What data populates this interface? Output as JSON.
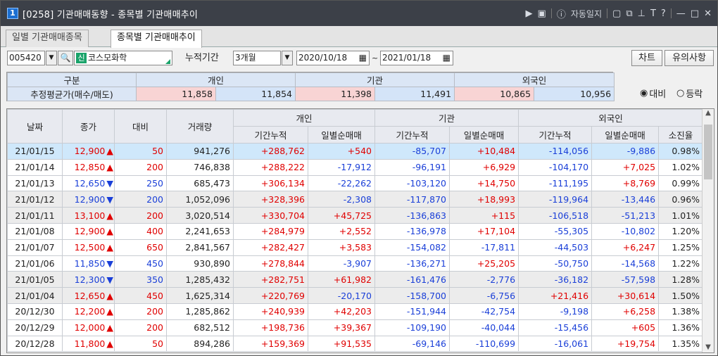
{
  "window": {
    "number": "1",
    "title": "[0258] 기관매매동향 - 종목별 기관매매추이",
    "journal_label": "자동일지"
  },
  "tabs": [
    {
      "label": "일별 기관매매종목"
    },
    {
      "label": "종목별 기관매매추이"
    }
  ],
  "toolbar": {
    "code": "005420",
    "badge": "신",
    "stock_name": "코스모화학",
    "period_label": "누적기간",
    "period_value": "3개월",
    "date_from": "2020/10/18",
    "date_sep": "~",
    "date_to": "2021/01/18",
    "chart_button": "차트",
    "notes_button": "유의사항"
  },
  "summary": {
    "header": [
      "구분",
      "개인",
      "기관",
      "외국인"
    ],
    "row_label": "추정평균가(매수/매도)",
    "values": [
      "11,858",
      "11,854",
      "11,398",
      "11,491",
      "10,865",
      "10,956"
    ]
  },
  "radio": {
    "opt1": "대비",
    "opt2": "등락",
    "selected": "대비"
  },
  "grid": {
    "headers": {
      "date": "날짜",
      "close": "종가",
      "change": "대비",
      "volume": "거래량",
      "individual": "개인",
      "institution": "기관",
      "foreign": "외국인",
      "cum": "기간누적",
      "daily": "일별순매매",
      "exhaust": "소진율"
    },
    "rows": [
      [
        "21/01/15",
        "12,900",
        "up",
        "50",
        "941,276",
        "+288,762",
        "+540",
        "-85,707",
        "+10,484",
        "-114,056",
        "-9,886",
        "0.98%"
      ],
      [
        "21/01/14",
        "12,850",
        "up",
        "200",
        "746,838",
        "+288,222",
        "-17,912",
        "-96,191",
        "+6,929",
        "-104,170",
        "+7,025",
        "1.02%"
      ],
      [
        "21/01/13",
        "12,650",
        "down",
        "250",
        "685,473",
        "+306,134",
        "-22,262",
        "-103,120",
        "+14,750",
        "-111,195",
        "+8,769",
        "0.99%"
      ],
      [
        "21/01/12",
        "12,900",
        "down",
        "200",
        "1,052,096",
        "+328,396",
        "-2,308",
        "-117,870",
        "+18,993",
        "-119,964",
        "-13,446",
        "0.96%"
      ],
      [
        "21/01/11",
        "13,100",
        "up",
        "200",
        "3,020,514",
        "+330,704",
        "+45,725",
        "-136,863",
        "+115",
        "-106,518",
        "-51,213",
        "1.01%"
      ],
      [
        "21/01/08",
        "12,900",
        "up",
        "400",
        "2,241,653",
        "+284,979",
        "+2,552",
        "-136,978",
        "+17,104",
        "-55,305",
        "-10,802",
        "1.20%"
      ],
      [
        "21/01/07",
        "12,500",
        "up",
        "650",
        "2,841,567",
        "+282,427",
        "+3,583",
        "-154,082",
        "-17,811",
        "-44,503",
        "+6,247",
        "1.25%"
      ],
      [
        "21/01/06",
        "11,850",
        "down",
        "450",
        "930,890",
        "+278,844",
        "-3,907",
        "-136,271",
        "+25,205",
        "-50,750",
        "-14,568",
        "1.22%"
      ],
      [
        "21/01/05",
        "12,300",
        "down",
        "350",
        "1,285,432",
        "+282,751",
        "+61,982",
        "-161,476",
        "-2,776",
        "-36,182",
        "-57,598",
        "1.28%"
      ],
      [
        "21/01/04",
        "12,650",
        "up",
        "450",
        "1,625,314",
        "+220,769",
        "-20,170",
        "-158,700",
        "-6,756",
        "+21,416",
        "+30,614",
        "1.50%"
      ],
      [
        "20/12/30",
        "12,200",
        "up",
        "200",
        "1,285,862",
        "+240,939",
        "+42,203",
        "-151,944",
        "-42,754",
        "-9,198",
        "+6,258",
        "1.38%"
      ],
      [
        "20/12/29",
        "12,000",
        "up",
        "200",
        "682,512",
        "+198,736",
        "+39,367",
        "-109,190",
        "-40,044",
        "-15,456",
        "+605",
        "1.36%"
      ],
      [
        "20/12/28",
        "11,800",
        "up",
        "50",
        "894,286",
        "+159,369",
        "+91,535",
        "-69,146",
        "-110,699",
        "-16,061",
        "+19,754",
        "1.35%"
      ]
    ]
  },
  "colors": {
    "up": "#e00000",
    "down": "#1a3fd8",
    "selected_row": "#cfe8fb",
    "titlebar": "#3c4048"
  }
}
